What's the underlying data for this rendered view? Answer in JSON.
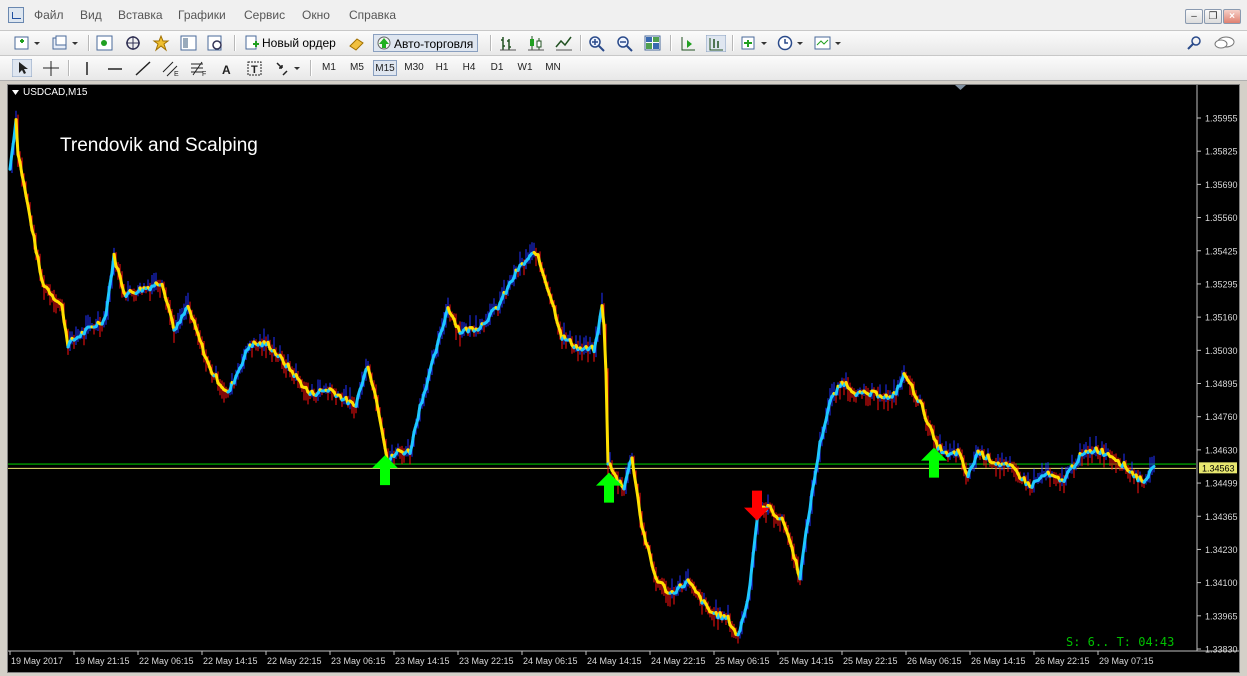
{
  "menu": {
    "items": [
      "Файл",
      "Вид",
      "Вставка",
      "Графики",
      "Сервис",
      "Окно",
      "Справка"
    ]
  },
  "toolbar": {
    "new_order_label": "Новый ордер",
    "auto_trading_label": "Авто-торговля"
  },
  "timeframes": {
    "items": [
      "M1",
      "M5",
      "M15",
      "M30",
      "H1",
      "H4",
      "D1",
      "W1",
      "MN"
    ],
    "active": "M15"
  },
  "chart": {
    "symbol_label": "USDCAD,M15",
    "overlay_text": "Trendovik and Scalping",
    "timer_text": "S: 6.. T: 04:43",
    "current_price_label": "1.34563",
    "colors": {
      "background": "#000000",
      "up": "#1ec8ff",
      "down": "#ffe000",
      "wick_up": "#2030ff",
      "wick_down": "#ff1010",
      "level_line": "#00c000",
      "price_line": "#e8e870",
      "buy_arrow": "#00ff00",
      "sell_arrow": "#ff0000",
      "timer": "#00c000"
    },
    "y_ticks": [
      "1.35955",
      "1.35825",
      "1.35690",
      "1.35560",
      "1.35425",
      "1.35295",
      "1.35160",
      "1.35030",
      "1.34895",
      "1.34760",
      "1.34630",
      "1.34499",
      "1.34365",
      "1.34230",
      "1.34100",
      "1.33965",
      "1.33830"
    ],
    "x_ticks": [
      "19 May 2017",
      "19 May 21:15",
      "22 May 06:15",
      "22 May 14:15",
      "22 May 22:15",
      "23 May 06:15",
      "23 May 14:15",
      "23 May 22:15",
      "24 May 06:15",
      "24 May 14:15",
      "24 May 22:15",
      "25 May 06:15",
      "25 May 14:15",
      "25 May 22:15",
      "26 May 06:15",
      "26 May 14:15",
      "26 May 22:15",
      "29 May 07:15"
    ]
  },
  "chart_data": {
    "type": "line",
    "title": "Trendovik and Scalping",
    "symbol": "USDCAD",
    "timeframe": "M15",
    "ylim": [
      1.3383,
      1.3605
    ],
    "current_price": 1.34563,
    "level_line": 1.3457,
    "x": [
      "19 May 2017",
      "19 May 21:15",
      "22 May 06:15",
      "22 May 14:15",
      "22 May 22:15",
      "23 May 06:15",
      "23 May 14:15",
      "23 May 22:15",
      "24 May 06:15",
      "24 May 14:15",
      "24 May 22:15",
      "25 May 06:15",
      "25 May 14:15",
      "25 May 22:15",
      "26 May 06:15",
      "26 May 14:15",
      "26 May 22:15",
      "29 May 07:15"
    ],
    "price": [
      [
        0,
        1.3575
      ],
      [
        6,
        1.3595
      ],
      [
        8,
        1.3582
      ],
      [
        18,
        1.356
      ],
      [
        32,
        1.353
      ],
      [
        52,
        1.352
      ],
      [
        58,
        1.3505
      ],
      [
        75,
        1.351
      ],
      [
        95,
        1.3515
      ],
      [
        104,
        1.354
      ],
      [
        115,
        1.3525
      ],
      [
        140,
        1.3528
      ],
      [
        152,
        1.353
      ],
      [
        165,
        1.351
      ],
      [
        178,
        1.352
      ],
      [
        200,
        1.3495
      ],
      [
        218,
        1.3485
      ],
      [
        240,
        1.3505
      ],
      [
        258,
        1.3505
      ],
      [
        280,
        1.3495
      ],
      [
        300,
        1.3485
      ],
      [
        320,
        1.3487
      ],
      [
        345,
        1.348
      ],
      [
        358,
        1.3497
      ],
      [
        368,
        1.348
      ],
      [
        378,
        1.3458
      ],
      [
        388,
        1.3462
      ],
      [
        400,
        1.3462
      ],
      [
        410,
        1.348
      ],
      [
        428,
        1.3505
      ],
      [
        438,
        1.352
      ],
      [
        450,
        1.351
      ],
      [
        470,
        1.3512
      ],
      [
        488,
        1.352
      ],
      [
        508,
        1.3535
      ],
      [
        526,
        1.3542
      ],
      [
        540,
        1.3525
      ],
      [
        552,
        1.3508
      ],
      [
        570,
        1.3503
      ],
      [
        585,
        1.3503
      ],
      [
        592,
        1.352
      ],
      [
        595,
        1.351
      ],
      [
        598,
        1.3458
      ],
      [
        605,
        1.3452
      ],
      [
        614,
        1.3448
      ],
      [
        622,
        1.346
      ],
      [
        632,
        1.3432
      ],
      [
        645,
        1.3412
      ],
      [
        660,
        1.3405
      ],
      [
        678,
        1.341
      ],
      [
        700,
        1.3398
      ],
      [
        718,
        1.3395
      ],
      [
        728,
        1.3388
      ],
      [
        738,
        1.3403
      ],
      [
        748,
        1.3438
      ],
      [
        758,
        1.344
      ],
      [
        775,
        1.3433
      ],
      [
        790,
        1.3412
      ],
      [
        800,
        1.344
      ],
      [
        810,
        1.3465
      ],
      [
        820,
        1.3482
      ],
      [
        833,
        1.349
      ],
      [
        848,
        1.3485
      ],
      [
        870,
        1.3485
      ],
      [
        882,
        1.3483
      ],
      [
        895,
        1.3493
      ],
      [
        912,
        1.348
      ],
      [
        926,
        1.3465
      ],
      [
        938,
        1.346
      ],
      [
        948,
        1.3462
      ],
      [
        958,
        1.3452
      ],
      [
        968,
        1.3462
      ],
      [
        984,
        1.3458
      ],
      [
        1004,
        1.3455
      ],
      [
        1020,
        1.3448
      ],
      [
        1036,
        1.3453
      ],
      [
        1052,
        1.345
      ],
      [
        1070,
        1.346
      ],
      [
        1086,
        1.3463
      ],
      [
        1104,
        1.346
      ],
      [
        1118,
        1.3455
      ],
      [
        1132,
        1.345
      ],
      [
        1144,
        1.3455
      ]
    ],
    "signals": [
      {
        "type": "buy",
        "time": "23 May 14:15",
        "price": 1.3455
      },
      {
        "type": "buy",
        "time": "24 May 14:15",
        "price": 1.3448
      },
      {
        "type": "sell",
        "time": "25 May 06:15",
        "price": 1.344
      },
      {
        "type": "buy",
        "time": "26 May 06:15",
        "price": 1.3458
      }
    ],
    "grid": false,
    "legend": "none"
  }
}
